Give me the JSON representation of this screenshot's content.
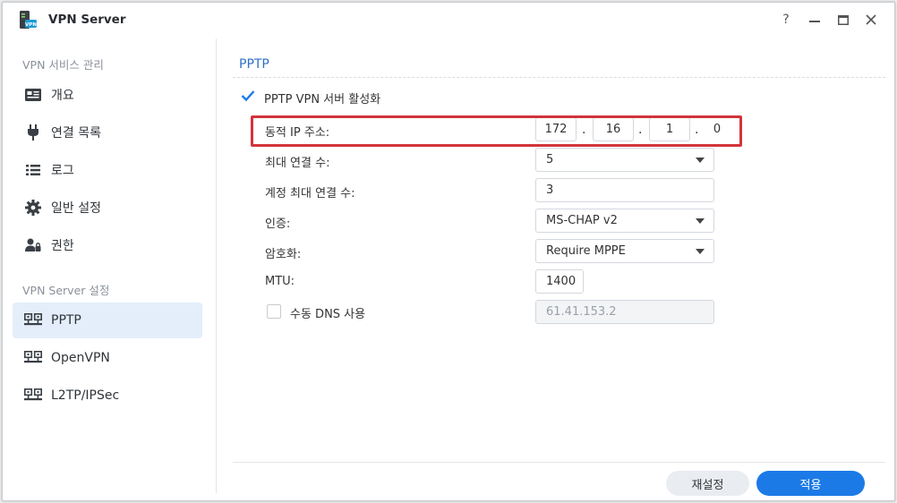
{
  "window": {
    "title": "VPN Server",
    "icon": "vpn-app-icon",
    "controls": [
      "help-icon",
      "minimize-icon",
      "maximize-icon",
      "close-icon"
    ],
    "help_label": "?"
  },
  "sidebar": {
    "section1": "VPN 서비스 관리",
    "items1": [
      {
        "label": "개요",
        "icon": "overview-icon"
      },
      {
        "label": "연결 목록",
        "icon": "plug-icon"
      },
      {
        "label": "로그",
        "icon": "list-icon"
      },
      {
        "label": "일반 설정",
        "icon": "gear-icon"
      },
      {
        "label": "권한",
        "icon": "user-permission-icon"
      }
    ],
    "section2": "VPN Server 설정",
    "items2": [
      {
        "label": "PPTP",
        "icon": "network-icon",
        "active": true
      },
      {
        "label": "OpenVPN",
        "icon": "network-icon"
      },
      {
        "label": "L2TP/IPSec",
        "icon": "network-icon"
      }
    ]
  },
  "main": {
    "title": "PPTP",
    "enable_label": "PPTP VPN 서버 활성화",
    "enable_checked": true,
    "dynamic_ip": {
      "label": "동적 IP 주소:",
      "octets": [
        "172",
        "16",
        "1",
        "0"
      ],
      "separator": "."
    },
    "max_conn": {
      "label": "최대 연결 수:",
      "value": "5"
    },
    "acct_max_conn": {
      "label": "계정 최대 연결 수:",
      "value": "3"
    },
    "auth": {
      "label": "인증:",
      "value": "MS-CHAP v2"
    },
    "encryption": {
      "label": "암호화:",
      "value": "Require MPPE"
    },
    "mtu": {
      "label": "MTU:",
      "value": "1400"
    },
    "manual_dns": {
      "label": "수동 DNS 사용",
      "checked": false,
      "value": "61.41.153.2"
    }
  },
  "footer": {
    "reset": "재설정",
    "apply": "적용"
  },
  "colors": {
    "accent": "#1c7ae6",
    "highlight": "#d2343a",
    "active_bg": "#e4eefb"
  }
}
